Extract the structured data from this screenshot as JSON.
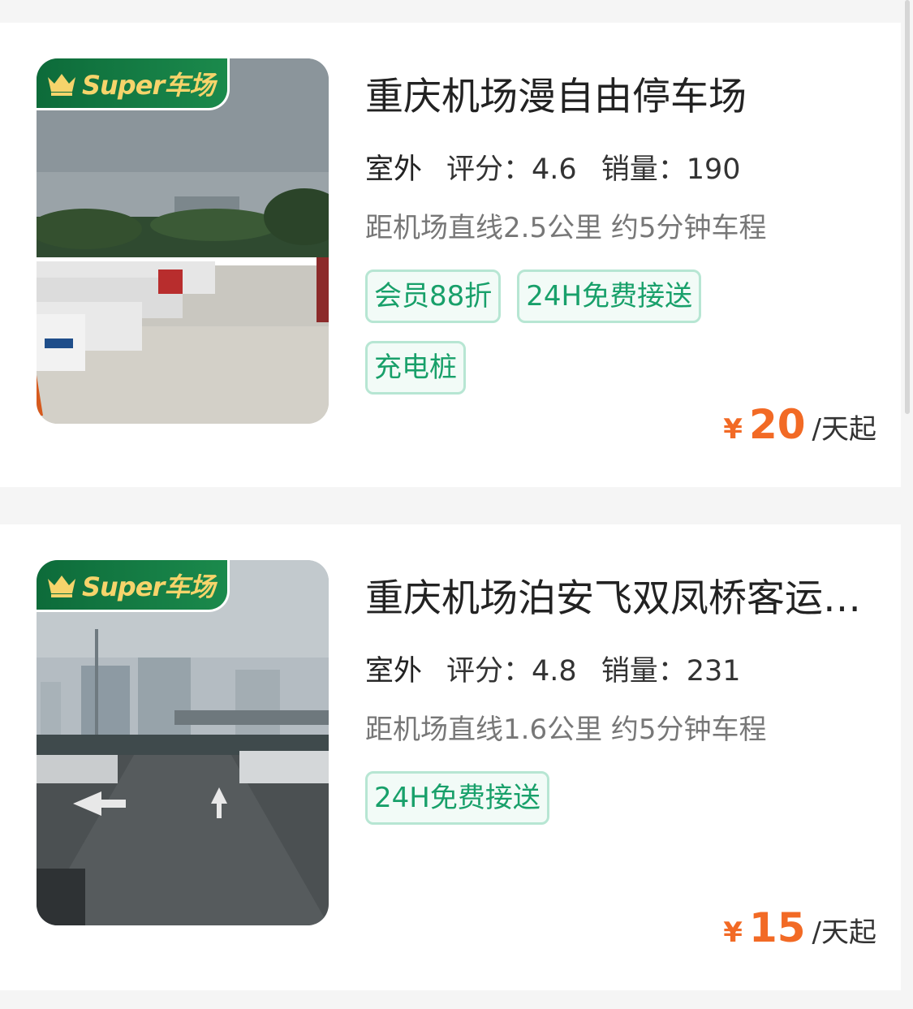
{
  "listings": [
    {
      "badge": "Super车场",
      "title": "重庆机场漫自由停车场",
      "type": "室外",
      "rating_label": "评分：",
      "rating": "4.6",
      "sales_label": "销量：",
      "sales": "190",
      "distance": "距机场直线2.5公里 约5分钟车程",
      "tags": [
        "会员88折",
        "24H免费接送",
        "充电桩"
      ],
      "currency": "¥",
      "price": "20",
      "price_unit": "/天起"
    },
    {
      "badge": "Super车场",
      "title": "重庆机场泊安飞双凤桥客运站停车场",
      "type": "室外",
      "rating_label": "评分：",
      "rating": "4.8",
      "sales_label": "销量：",
      "sales": "231",
      "distance": "距机场直线1.6公里 约5分钟车程",
      "tags": [
        "24H免费接送"
      ],
      "currency": "¥",
      "price": "15",
      "price_unit": "/天起"
    }
  ],
  "colors": {
    "accent_green": "#18a06a",
    "price_orange": "#f26a25",
    "badge_green": "#0d6b3a",
    "badge_gold": "#f6d46b"
  }
}
